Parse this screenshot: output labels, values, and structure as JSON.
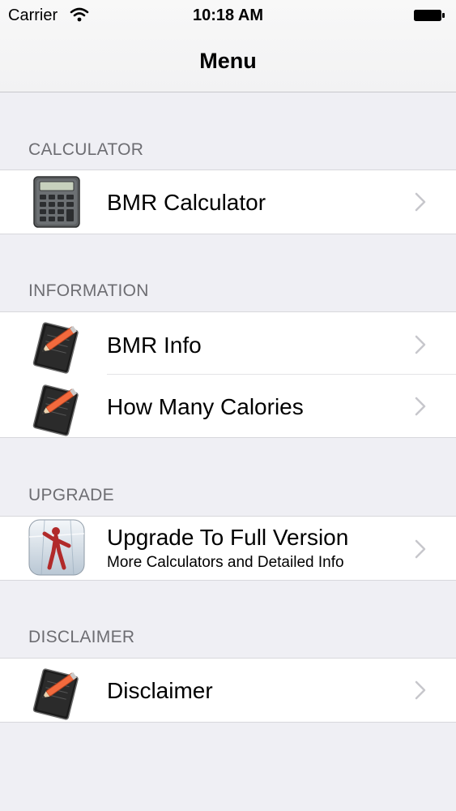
{
  "status_bar": {
    "carrier": "Carrier",
    "time": "10:18 AM"
  },
  "nav": {
    "title": "Menu"
  },
  "sections": [
    {
      "header": "CALCULATOR",
      "items": [
        {
          "title": "BMR Calculator",
          "icon": "calculator-icon"
        }
      ]
    },
    {
      "header": "INFORMATION",
      "items": [
        {
          "title": "BMR Info",
          "icon": "notebook-pencil-icon"
        },
        {
          "title": "How Many Calories",
          "icon": "notebook-pencil-icon"
        }
      ]
    },
    {
      "header": "UPGRADE",
      "items": [
        {
          "title": "Upgrade To Full Version",
          "subtitle": "More Calculators and Detailed Info",
          "icon": "app-upgrade-icon"
        }
      ]
    },
    {
      "header": "DISCLAIMER",
      "items": [
        {
          "title": "Disclaimer",
          "icon": "notebook-pencil-icon"
        }
      ]
    }
  ],
  "colors": {
    "background": "#efeff4",
    "header_text": "#6d6d72",
    "chevron": "#c7c7cc",
    "accent_pencil": "#f26a3d"
  }
}
